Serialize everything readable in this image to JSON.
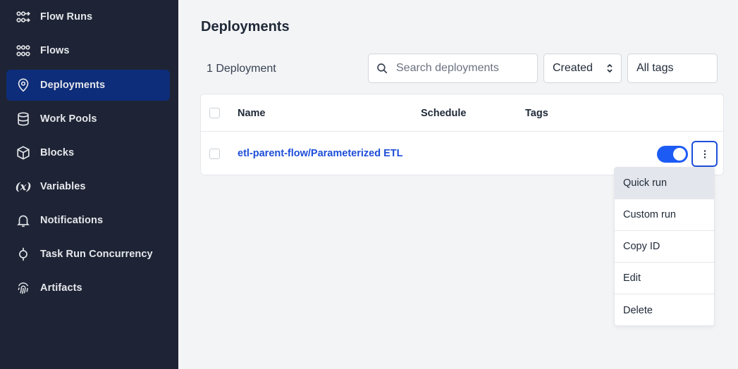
{
  "sidebar": {
    "items": [
      {
        "label": "Flow Runs",
        "icon": "flow-runs-icon",
        "active": false
      },
      {
        "label": "Flows",
        "icon": "flows-icon",
        "active": false
      },
      {
        "label": "Deployments",
        "icon": "map-pin-icon",
        "active": true
      },
      {
        "label": "Work Pools",
        "icon": "database-icon",
        "active": false
      },
      {
        "label": "Blocks",
        "icon": "cube-icon",
        "active": false
      },
      {
        "label": "Variables",
        "icon": "variable-icon",
        "icon_glyph": "(x)",
        "active": false
      },
      {
        "label": "Notifications",
        "icon": "bell-icon",
        "active": false
      },
      {
        "label": "Task Run Concurrency",
        "icon": "concurrency-icon",
        "active": false
      },
      {
        "label": "Artifacts",
        "icon": "fingerprint-icon",
        "active": false
      }
    ]
  },
  "main": {
    "title": "Deployments",
    "count_label": "1 Deployment",
    "search": {
      "placeholder": "Search deployments",
      "value": ""
    },
    "sort": {
      "selected": "Created"
    },
    "tags_filter": {
      "label": "All tags"
    },
    "table": {
      "columns": [
        "Name",
        "Schedule",
        "Tags"
      ],
      "rows": [
        {
          "name": "etl-parent-flow/Parameterized ETL",
          "schedule": "",
          "tags": "",
          "active": true
        }
      ]
    },
    "row_menu": {
      "items": [
        "Quick run",
        "Custom run",
        "Copy ID",
        "Edit",
        "Delete"
      ],
      "hovered": "Quick run"
    }
  },
  "colors": {
    "sidebar_bg": "#1e2435",
    "active_nav": "#0d2d7a",
    "accent": "#1d5bf5",
    "link": "#1d4ed8",
    "page_bg": "#f3f4f6"
  }
}
